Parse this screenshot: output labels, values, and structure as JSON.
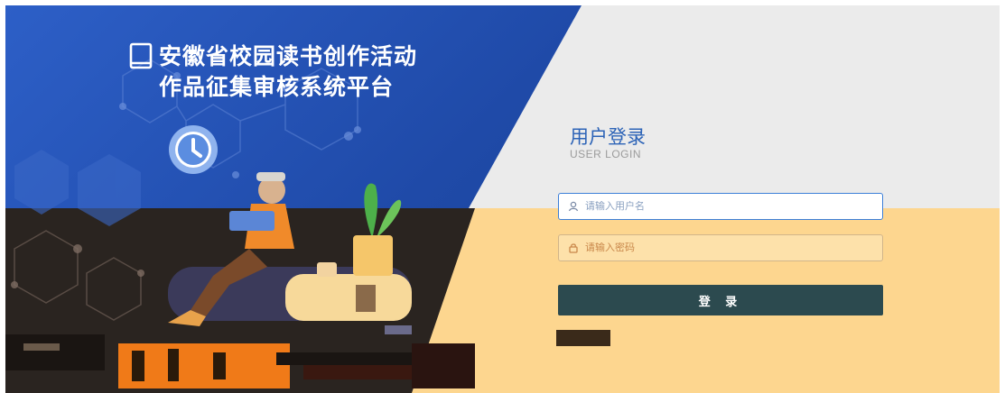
{
  "brand": {
    "title_line1": "安徽省校园读书创作活动",
    "title_line2": "作品征集审核系统平台",
    "book_icon": "book-icon",
    "clock_icon": "clock-icon"
  },
  "login": {
    "title": "用户登录",
    "subtitle": "USER LOGIN",
    "username_placeholder": "请输入用户名",
    "password_placeholder": "请输入密码",
    "submit_label": "登 录",
    "user_icon": "user-icon",
    "lock_icon": "lock-icon"
  },
  "colors": {
    "panel_blue": "#1f4aa8",
    "accent_blue": "#2c63b7",
    "button": "#2c4a4f",
    "band": "#fdd68f",
    "figure_orange": "#f08a2a"
  }
}
